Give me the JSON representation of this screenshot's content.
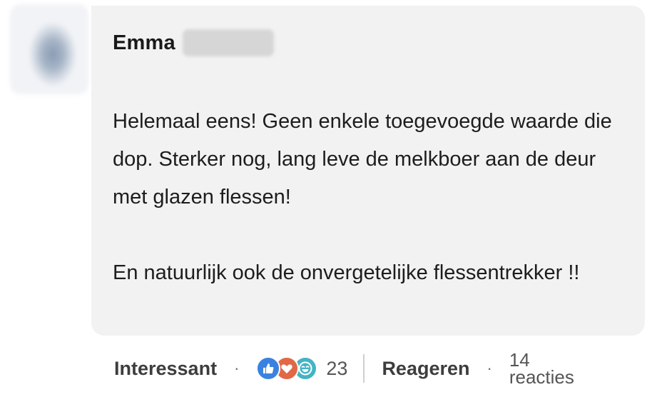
{
  "comment": {
    "author_first_name": "Emma",
    "paragraphs": [
      "Helemaal eens! Geen enkele toegevoegde waarde die dop. Sterker nog, lang leve de melkboer aan de deur met glazen flessen!",
      "En natuurlijk ook de onvergetelijke flessentrekker !!"
    ]
  },
  "footer": {
    "react_label": "Interessant",
    "separator": "·",
    "reaction_count": "23",
    "reply_label": "Reageren",
    "reply_count": "14",
    "reply_count_label": "reacties",
    "reaction_icons": [
      "like-icon",
      "love-icon",
      "funny-icon"
    ]
  },
  "colors": {
    "bubble_bg": "#f2f2f2",
    "like": "#3b82e0",
    "love": "#e06847",
    "funny": "#44b4c4"
  }
}
